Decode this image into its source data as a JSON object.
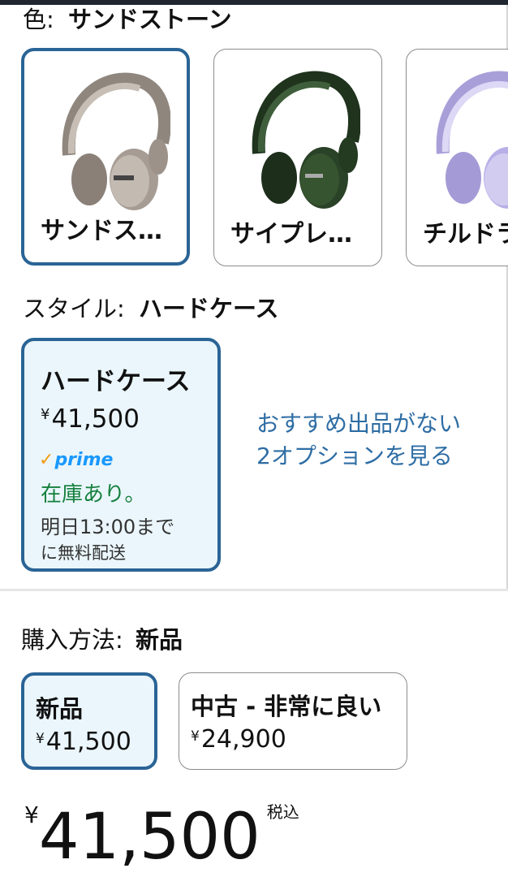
{
  "color": {
    "label": "色:",
    "value": "サンドストーン",
    "options": [
      {
        "name": "サンドス…",
        "tone": "#b5aba3",
        "dark": "#7d736b"
      },
      {
        "name": "サイプレ…",
        "tone": "#2f4a2c",
        "dark": "#1b2c19"
      },
      {
        "name": "チルドラ",
        "tone": "#c9c2ec",
        "dark": "#9d94d4"
      }
    ]
  },
  "style": {
    "label": "スタイル:",
    "value": "ハードケース",
    "card": {
      "title": "ハードケース",
      "currency": "¥",
      "price": "41,500",
      "prime": "prime",
      "stock": "在庫あり。",
      "delivery_line1": "明日13:00まで",
      "delivery_line2": "に無料配送"
    },
    "more_options": "おすすめ出品がない2オプションを見る"
  },
  "purchase": {
    "label": "購入方法:",
    "value": "新品",
    "options": [
      {
        "label": "新品",
        "currency": "¥",
        "price": "41,500"
      },
      {
        "label": "中古 - 非常に良い",
        "currency": "¥",
        "price": "24,900"
      }
    ]
  },
  "total": {
    "currency": "¥",
    "price": "41,500",
    "tax_note": "税込"
  }
}
